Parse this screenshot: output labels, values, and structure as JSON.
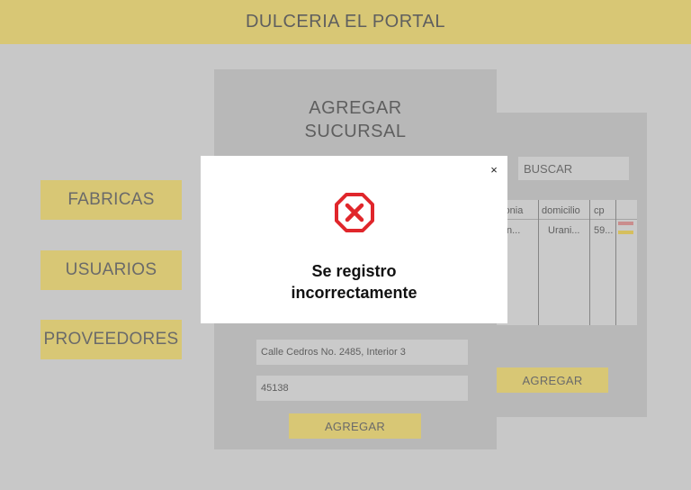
{
  "header": {
    "title": "DULCERIA EL PORTAL"
  },
  "nav": [
    {
      "label": "FABRICAS"
    },
    {
      "label": "USUARIOS"
    },
    {
      "label": "PROVEEDORES"
    }
  ],
  "form": {
    "title_line1": "AGREGAR",
    "title_line2": "SUCURSAL",
    "fields": [
      {
        "value": "Calle Cedros No. 2485, Interior 3"
      },
      {
        "value": "45138"
      }
    ],
    "submit_label": "AGREGAR"
  },
  "list": {
    "search_label": "BUSCAR",
    "columns": [
      "olonia",
      "domicilio",
      "cp"
    ],
    "rows": [
      {
        "colonia": "alin...",
        "domicilio": "Urani...",
        "cp": "59..."
      }
    ],
    "add_label": "AGREGAR",
    "action_colors": {
      "delete": "#e8a2a2",
      "edit": "#f5dc6c"
    }
  },
  "modal": {
    "close_symbol": "×",
    "icon": "error-octagon-icon",
    "icon_color": "#e0262b",
    "message_line1": "Se registro",
    "message_line2": "incorrectamente"
  },
  "colors": {
    "accent_yellow": "#f9e587",
    "panel_gray": "#d4d4d4",
    "page_bg": "#e6e6e6"
  }
}
